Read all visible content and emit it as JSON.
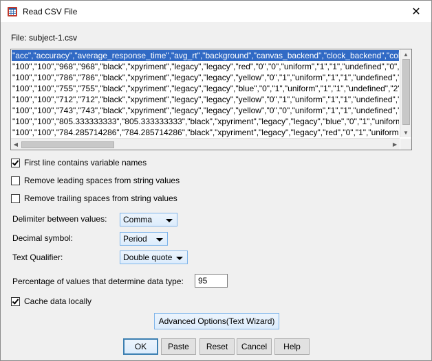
{
  "window": {
    "title": "Read CSV File",
    "close_glyph": "✕"
  },
  "file": {
    "label": "File: subject-1.csv"
  },
  "preview": {
    "lines": [
      "\"acc\",\"accuracy\",\"average_response_time\",\"avg_rt\",\"background\",\"canvas_backend\",\"clock_backend\",\"colo",
      "\"100\",\"100\",\"968\",\"968\",\"black\",\"xpyriment\",\"legacy\",\"legacy\",\"red\",\"0\",\"0\",\"uniform\",\"1\",\"1\",\"undefined\",\"0\",\"0\",",
      "\"100\",\"100\",\"786\",\"786\",\"black\",\"xpyriment\",\"legacy\",\"legacy\",\"yellow\",\"0\",\"1\",\"uniform\",\"1\",\"1\",\"undefined\",\"1\",\"",
      "\"100\",\"100\",\"755\",\"755\",\"black\",\"xpyriment\",\"legacy\",\"legacy\",\"blue\",\"0\",\"1\",\"uniform\",\"1\",\"1\",\"undefined\",\"2\",\"0\"",
      "\"100\",\"100\",\"712\",\"712\",\"black\",\"xpyriment\",\"legacy\",\"legacy\",\"yellow\",\"0\",\"1\",\"uniform\",\"1\",\"1\",\"undefined\",\"3\",\"",
      "\"100\",\"100\",\"743\",\"743\",\"black\",\"xpyriment\",\"legacy\",\"legacy\",\"yellow\",\"0\",\"0\",\"uniform\",\"1\",\"1\",\"undefined\",\"4\",\"",
      "\"100\",\"100\",\"805.333333333\",\"805.333333333\",\"black\",\"xpyriment\",\"legacy\",\"legacy\",\"blue\",\"0\",\"1\",\"uniform\",\"",
      "\"100\",\"100\",\"784.285714286\",\"784.285714286\",\"black\",\"xpyriment\",\"legacy\",\"legacy\",\"red\",\"0\",\"1\",\"uniform\",\""
    ],
    "selected_index": 0
  },
  "options": {
    "first_line_label": "First line contains variable names",
    "first_line_checked": true,
    "remove_leading_label": "Remove leading spaces from string values",
    "remove_leading_checked": false,
    "remove_trailing_label": "Remove trailing spaces from string values",
    "remove_trailing_checked": false
  },
  "delimiter": {
    "label": "Delimiter between values:",
    "value": "Comma"
  },
  "decimal": {
    "label": "Decimal symbol:",
    "value": "Period"
  },
  "qualifier": {
    "label": "Text Qualifier:",
    "value": "Double quote"
  },
  "percentage": {
    "label": "Percentage of values that determine data type:",
    "value": "95"
  },
  "cache": {
    "label": "Cache data locally",
    "checked": true
  },
  "buttons": {
    "advanced": "Advanced Options(Text Wizard)",
    "ok": "OK",
    "paste": "Paste",
    "reset": "Reset",
    "cancel": "Cancel",
    "help": "Help"
  },
  "colors": {
    "selection": "#316ac5",
    "button_border": "#7eb4ea"
  }
}
